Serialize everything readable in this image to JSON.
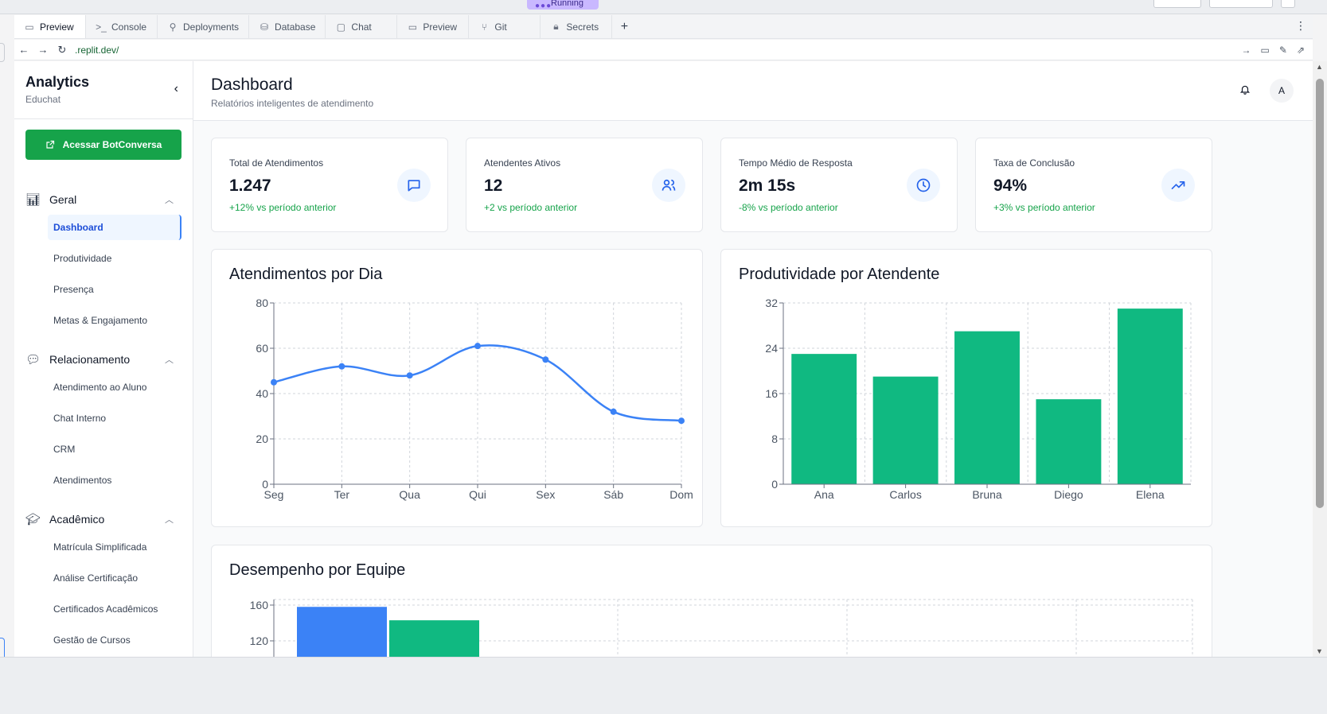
{
  "topbar": {
    "running_label": "Running"
  },
  "tabs": [
    {
      "label": "Preview",
      "icon": "monitor-icon",
      "glyph": "▭"
    },
    {
      "label": "Console",
      "icon": "terminal-icon",
      "glyph": ">_"
    },
    {
      "label": "Deployments",
      "icon": "deploy-icon",
      "glyph": "⚲"
    },
    {
      "label": "Database",
      "icon": "database-icon",
      "glyph": "⛁"
    },
    {
      "label": "Chat",
      "icon": "chat-icon",
      "glyph": "▢"
    },
    {
      "label": "Preview",
      "icon": "monitor-icon",
      "glyph": "▭"
    },
    {
      "label": "Git",
      "icon": "git-icon",
      "glyph": "⑂"
    },
    {
      "label": "Secrets",
      "icon": "lock-icon",
      "glyph": "🔒︎"
    }
  ],
  "urlbar": {
    "url": ".replit.dev/"
  },
  "sidebar": {
    "title": "Analytics",
    "subtitle": "Educhat",
    "cta_label": "Acessar BotConversa",
    "sections": [
      {
        "label": "Geral",
        "items": [
          "Dashboard",
          "Produtividade",
          "Presença",
          "Metas & Engajamento"
        ]
      },
      {
        "label": "Relacionamento",
        "items": [
          "Atendimento ao Aluno",
          "Chat Interno",
          "CRM",
          "Atendimentos"
        ]
      },
      {
        "label": "Acadêmico",
        "items": [
          "Matrícula Simplificada",
          "Análise Certificação",
          "Certificados Acadêmicos",
          "Gestão de Cursos"
        ]
      }
    ],
    "active_item": "Dashboard"
  },
  "header": {
    "title": "Dashboard",
    "subtitle": "Relatórios inteligentes de atendimento",
    "avatar_initial": "A"
  },
  "kpis": [
    {
      "label": "Total de Atendimentos",
      "value": "1.247",
      "delta": "+12% vs período anterior",
      "icon": "message-icon"
    },
    {
      "label": "Atendentes Ativos",
      "value": "12",
      "delta": "+2 vs período anterior",
      "icon": "users-icon"
    },
    {
      "label": "Tempo Médio de Resposta",
      "value": "2m 15s",
      "delta": "-8% vs período anterior",
      "icon": "clock-icon"
    },
    {
      "label": "Taxa de Conclusão",
      "value": "94%",
      "delta": "+3% vs período anterior",
      "icon": "trending-up-icon"
    }
  ],
  "colors": {
    "accent": "#3b82f6",
    "green": "#10b981",
    "success": "#16a34a"
  },
  "chart_data": [
    {
      "type": "line",
      "title": "Atendimentos por Dia",
      "categories": [
        "Seg",
        "Ter",
        "Qua",
        "Qui",
        "Sex",
        "Sáb",
        "Dom"
      ],
      "series": [
        {
          "values": [
            45,
            52,
            48,
            61,
            55,
            32,
            28
          ],
          "color": "#3b82f6"
        }
      ],
      "ylim": [
        0,
        80
      ],
      "yticks": [
        0,
        20,
        40,
        60,
        80
      ],
      "grid": true
    },
    {
      "type": "bar",
      "title": "Produtividade por Atendente",
      "categories": [
        "Ana",
        "Carlos",
        "Bruna",
        "Diego",
        "Elena"
      ],
      "series": [
        {
          "values": [
            23,
            19,
            27,
            15,
            31
          ],
          "color": "#10b981"
        }
      ],
      "ylim": [
        0,
        32
      ],
      "yticks": [
        0,
        8,
        16,
        24,
        32
      ],
      "grid": true
    },
    {
      "type": "bar",
      "title": "Desempenho por Equipe",
      "series": [
        {
          "values": [
            158
          ],
          "color": "#3b82f6"
        },
        {
          "values": [
            143
          ],
          "color": "#10b981"
        }
      ],
      "yticks": [
        120,
        160
      ],
      "grid": true
    }
  ]
}
